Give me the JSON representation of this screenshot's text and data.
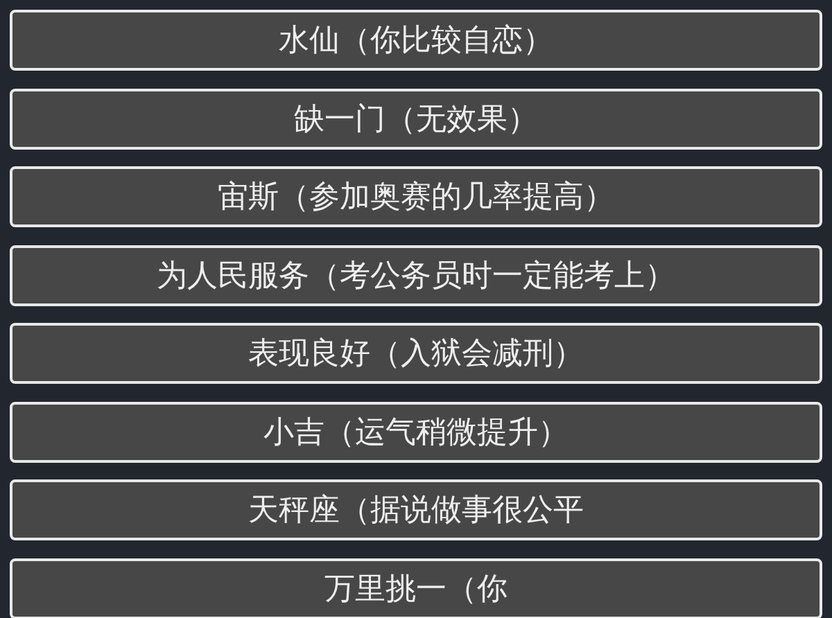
{
  "options": [
    {
      "label": "水仙（你比较自恋）"
    },
    {
      "label": "缺一门（无效果）"
    },
    {
      "label": "宙斯（参加奥赛的几率提高）"
    },
    {
      "label": "为人民服务（考公务员时一定能考上）"
    },
    {
      "label": "表现良好（入狱会减刑）"
    },
    {
      "label": "小吉（运气稍微提升）"
    },
    {
      "label": "天秤座（据说做事很公平"
    },
    {
      "label": "万里挑一（你"
    }
  ]
}
